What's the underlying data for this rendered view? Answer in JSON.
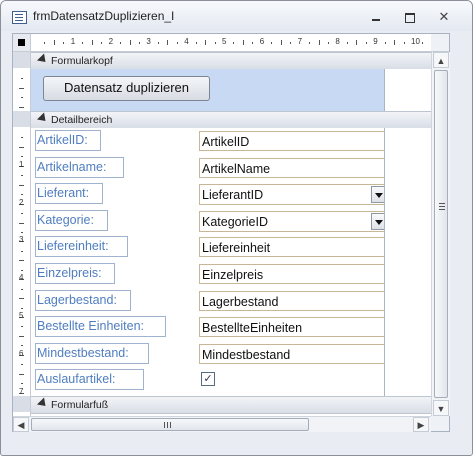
{
  "window": {
    "title": "frmDatensatzDuplizieren_I",
    "minimize_icon": "minimize-icon",
    "maximize_icon": "maximize-icon",
    "close_icon": "close-icon",
    "close_glyph": "✕"
  },
  "ruler": {
    "h_numbers": [
      "1",
      "2",
      "3",
      "4",
      "5",
      "6",
      "7",
      "8",
      "9",
      "10"
    ],
    "v_numbers": [
      "1",
      "2",
      "3",
      "4",
      "5",
      "6",
      "7"
    ]
  },
  "sections": {
    "header_label": "Formularkopf",
    "detail_label": "Detailbereich",
    "footer_label": "Formularfuß"
  },
  "header": {
    "duplicate_button_label": "Datensatz duplizieren"
  },
  "fields": [
    {
      "label": "ArtikelID:",
      "control": "ArtikelID",
      "type": "text"
    },
    {
      "label": "Artikelname:",
      "control": "ArtikelName",
      "type": "text"
    },
    {
      "label": "Lieferant:",
      "control": "LieferantID",
      "type": "combo"
    },
    {
      "label": "Kategorie:",
      "control": "KategorieID",
      "type": "combo"
    },
    {
      "label": "Liefereinheit:",
      "control": "Liefereinheit",
      "type": "text"
    },
    {
      "label": "Einzelpreis:",
      "control": "Einzelpreis",
      "type": "text"
    },
    {
      "label": "Lagerbestand:",
      "control": "Lagerbestand",
      "type": "text"
    },
    {
      "label": "Bestellte Einheiten:",
      "control": "BestellteEinheiten",
      "type": "text"
    },
    {
      "label": "Mindestbestand:",
      "control": "Mindestbestand",
      "type": "text"
    },
    {
      "label": "Auslaufartikel:",
      "control": "",
      "type": "checkbox",
      "checked": true
    }
  ],
  "glyphs": {
    "check": "✓",
    "scroll_up": "▲",
    "scroll_down": "▼",
    "scroll_left": "◀",
    "scroll_right": "▶"
  },
  "colors": {
    "label_text": "#4f7ec0",
    "header_background": "#c8daf3",
    "control_border": "#c6b896"
  }
}
